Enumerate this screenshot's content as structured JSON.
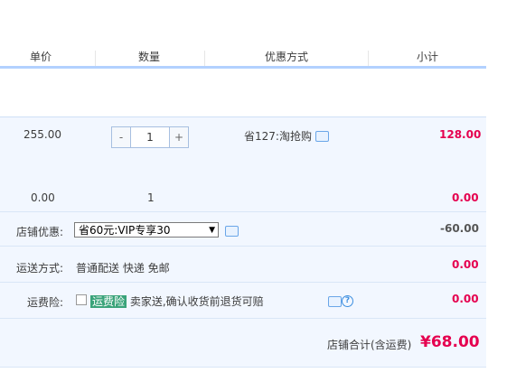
{
  "table_header": {
    "unit_price": "单价",
    "quantity": "数量",
    "discount_method": "优惠方式",
    "subtotal": "小计"
  },
  "item": {
    "unit_price": "255.00",
    "quantity": "1",
    "qty_minus": "-",
    "qty_plus": "+",
    "discount": "省127:淘抢购",
    "subtotal": "128.00"
  },
  "extra_row": {
    "unit_price": "0.00",
    "quantity": "1",
    "subtotal": "0.00"
  },
  "shop_discount": {
    "label": "店铺优惠:",
    "selected": "省60元:VIP专享30",
    "amount": "-60.00"
  },
  "shipping": {
    "label": "运送方式:",
    "value": "普通配送 快递 免邮",
    "amount": "0.00"
  },
  "shipping_insurance": {
    "label": "运费险:",
    "tag": "运费险",
    "description": "卖家送,确认收货前退货可赔",
    "amount": "0.00",
    "help": "?"
  },
  "total": {
    "label": "店铺合计(含运费)",
    "amount": "¥68.00"
  },
  "colors": {
    "price_red": "#e5004f",
    "row_bg": "#f2f7ff",
    "header_line": "#b2d1ff"
  }
}
